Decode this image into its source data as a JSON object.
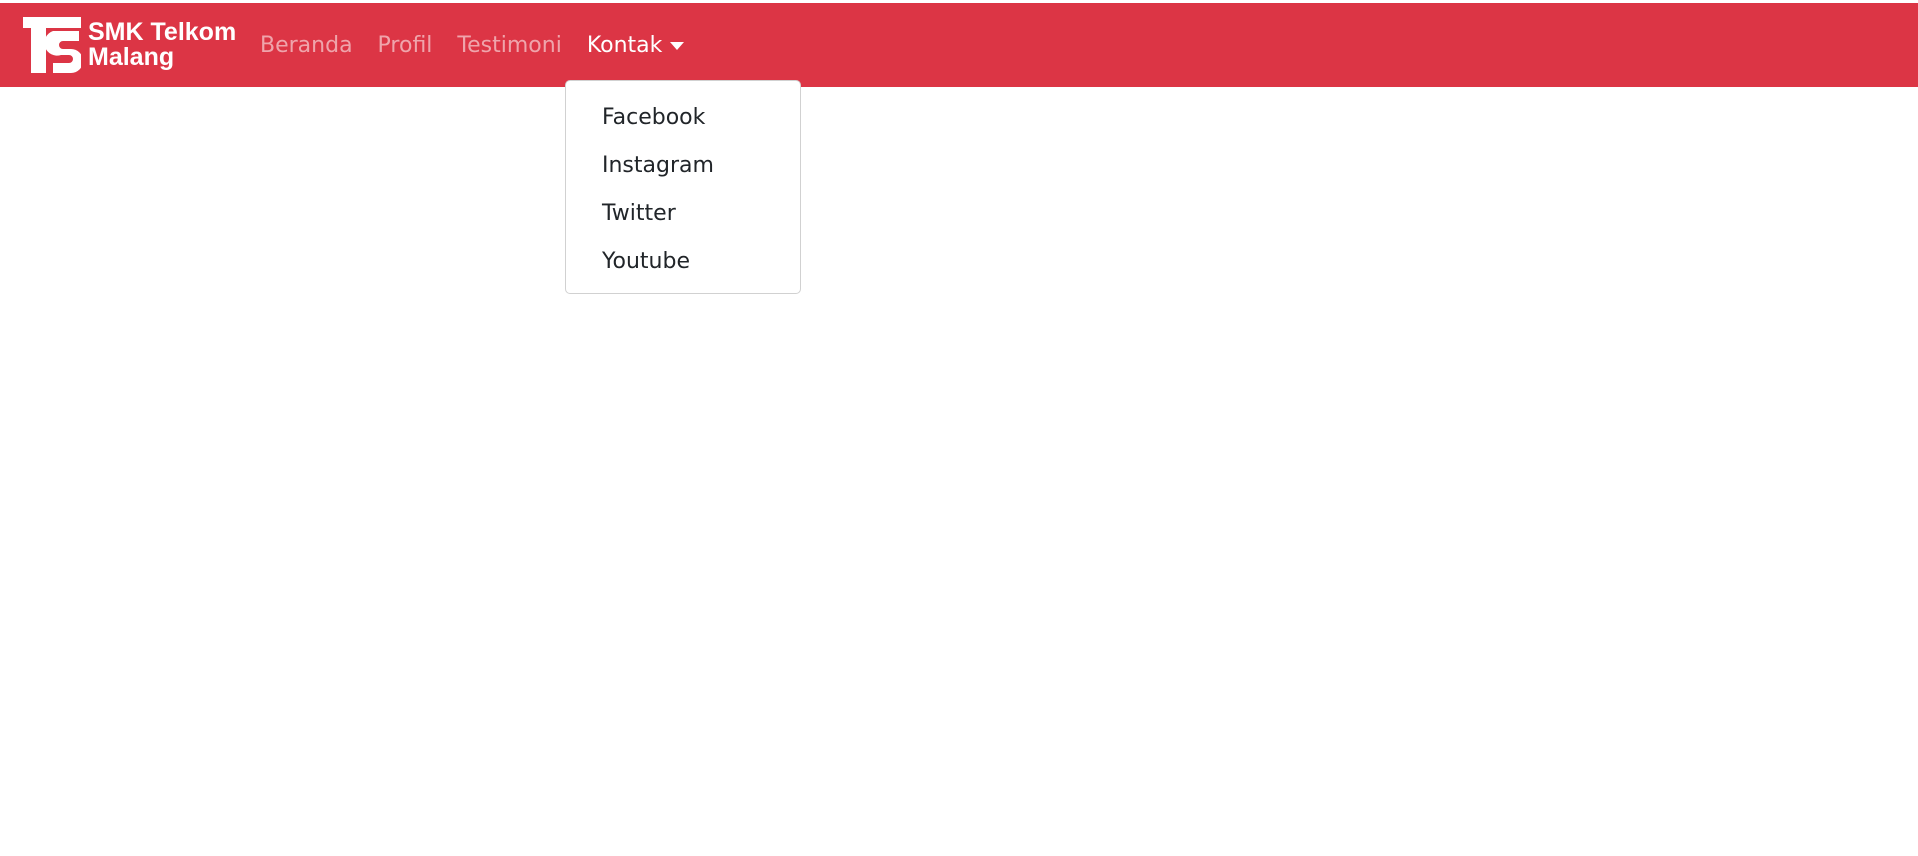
{
  "brand": {
    "line1": "SMK Telkom",
    "line2": "Malang",
    "logo_icon": "telkom-ts-logo-icon"
  },
  "colors": {
    "navbar_bg": "#dc3545",
    "link_muted": "rgba(255,255,255,0.55)",
    "link_active": "#ffffff",
    "dropdown_text": "#212529"
  },
  "nav": {
    "items": [
      {
        "label": "Beranda"
      },
      {
        "label": "Profil"
      },
      {
        "label": "Testimoni"
      },
      {
        "label": "Kontak",
        "active": true,
        "icon": "caret-down-icon"
      }
    ]
  },
  "dropdown": {
    "items": [
      {
        "label": "Facebook"
      },
      {
        "label": "Instagram"
      },
      {
        "label": "Twitter"
      },
      {
        "label": "Youtube"
      }
    ]
  }
}
